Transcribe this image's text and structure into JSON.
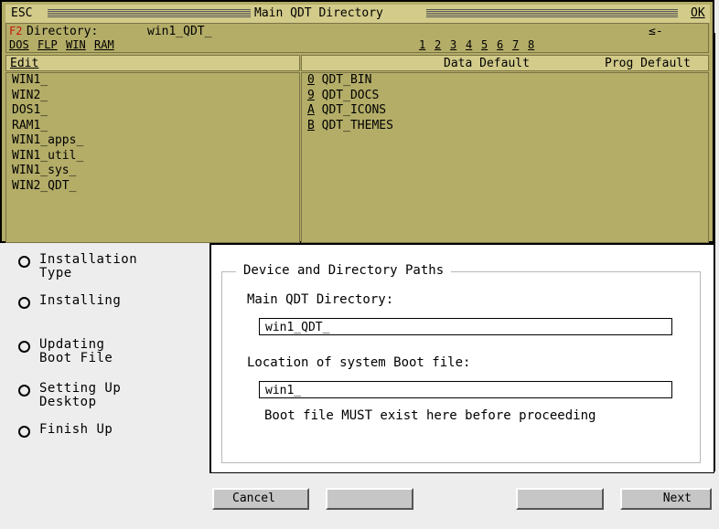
{
  "window": {
    "esc_label": "ESC",
    "title": "Main QDT Directory",
    "ok_label": "OK"
  },
  "info": {
    "fkey": "F2",
    "directory_label": "Directory:",
    "directory_value": "win1_QDT_",
    "back_arrow": "≤-",
    "devices": [
      "DOS",
      "FLP",
      "WIN",
      "RAM"
    ],
    "slots": [
      "1",
      "2",
      "3",
      "4",
      "5",
      "6",
      "7",
      "8"
    ]
  },
  "left_list": {
    "header": "Edit",
    "items": [
      "WIN1_",
      "WIN2_",
      "DOS1_",
      "RAM1_",
      "WIN1_apps_",
      "WIN1_util_",
      "WIN1_sys_",
      "WIN2_QDT_"
    ]
  },
  "right_list": {
    "data_default": "Data Default",
    "prog_default": "Prog Default",
    "items": [
      {
        "key": "0",
        "label": "QDT_BIN"
      },
      {
        "key": "9",
        "label": "QDT_DOCS"
      },
      {
        "key": "A",
        "label": "QDT_ICONS"
      },
      {
        "key": "B",
        "label": "QDT_THEMES"
      }
    ]
  },
  "wizard": {
    "steps": [
      "Installation\nType",
      "Installing",
      "Updating\nBoot File",
      "Setting Up\nDesktop",
      "Finish Up"
    ],
    "group_title": "Device and Directory Paths",
    "main_dir_label": "Main QDT Directory:",
    "main_dir_value": "win1_QDT_",
    "boot_label": "Location of system Boot file:",
    "boot_value": "win1_",
    "boot_note": "Boot file MUST exist here before proceeding",
    "cancel_label": "Cancel",
    "next_label": "Next"
  }
}
